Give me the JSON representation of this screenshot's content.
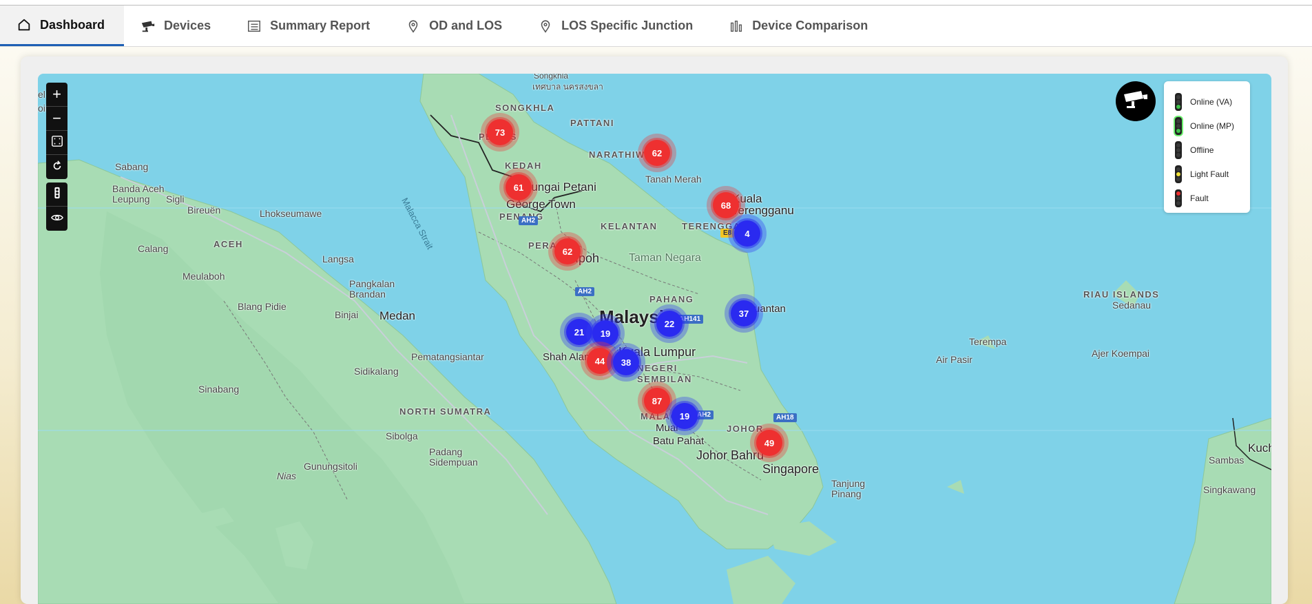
{
  "tabs": [
    {
      "label": "Dashboard",
      "icon": "home-icon",
      "active": true
    },
    {
      "label": "Devices",
      "icon": "cctv-camera-icon"
    },
    {
      "label": "Summary Report",
      "icon": "report-list-icon"
    },
    {
      "label": "OD and LOS",
      "icon": "location-pin-icon"
    },
    {
      "label": "LOS Specific Junction",
      "icon": "location-pin-icon"
    },
    {
      "label": "Device Comparison",
      "icon": "bar-chart-icon"
    }
  ],
  "map": {
    "controls": {
      "zoom_in": "+",
      "zoom_out": "−",
      "fullscreen_icon": "fullscreen-icon",
      "reset_icon": "refresh-icon",
      "traffic_toggle_icon": "traffic-light-icon",
      "visibility_icon": "eye-icon"
    },
    "camera_button_icon": "cctv-camera-icon",
    "legend": [
      {
        "label": "Online (VA)",
        "lamp": "green",
        "color": "#3fc24a"
      },
      {
        "label": "Online (MP)",
        "lamp": "green-outline",
        "color": "#6df06f"
      },
      {
        "label": "Offline",
        "lamp": "none",
        "color": "#3a3a3a"
      },
      {
        "label": "Light Fault",
        "lamp": "yellow",
        "color": "#f2e23a"
      },
      {
        "label": "Fault",
        "lamp": "red",
        "color": "#ee3030"
      }
    ],
    "clusters": [
      {
        "count": "73",
        "color": "red"
      },
      {
        "count": "62",
        "color": "red"
      },
      {
        "count": "61",
        "color": "red"
      },
      {
        "count": "68",
        "color": "red"
      },
      {
        "count": "4",
        "color": "blue"
      },
      {
        "count": "62",
        "color": "red"
      },
      {
        "count": "37",
        "color": "blue"
      },
      {
        "count": "22",
        "color": "blue"
      },
      {
        "count": "21",
        "color": "blue"
      },
      {
        "count": "19",
        "color": "blue"
      },
      {
        "count": "44",
        "color": "red"
      },
      {
        "count": "38",
        "color": "blue"
      },
      {
        "count": "87",
        "color": "red"
      },
      {
        "count": "19",
        "color": "blue"
      },
      {
        "count": "49",
        "color": "red"
      }
    ],
    "labels": {
      "songkhla_th": "Songkhla",
      "songkhla_thai": "เทศบาล นครสงขลา",
      "songkhla": "SONGKHLA",
      "pattani": "PATTANI",
      "perlis": "PERLIS",
      "narathiwat": "NARATHIWAT",
      "kedah": "KEDAH",
      "tanah_merah": "Tanah Merah",
      "sungai_petani": "Sungai Petani",
      "george_town": "George Town",
      "penang": "PENANG",
      "kelantan": "KELANTAN",
      "kuala_terengganu": "Kuala Terengganu",
      "terengganu": "TERENGGANU",
      "perak": "PERAK",
      "ipoh": "Ipoh",
      "taman_negara": "Taman Negara",
      "pahang": "PAHANG",
      "malaysia": "Malaysia",
      "kuantan": "Kuantan",
      "shah_alam": "Shah Alam",
      "kuala_lumpur": "Kuala Lumpur",
      "negeri_sembilan": "NEGERI SEMBILAN",
      "malacca": "MALACCA",
      "muar": "Muar",
      "batu_pahat": "Batu Pahat",
      "johor": "JOHOR",
      "johor_bahru": "Johor Bahru",
      "singapore": "Singapore",
      "tanjung_pinang": "Tanjung Pinang",
      "sabang": "Sabang",
      "banda_aceh": "Banda Aceh",
      "leupung": "Leupung",
      "sigli": "Sigli",
      "bireuen": "Bireuën",
      "lhokseumawe": "Lhokseumawe",
      "aceh": "ACEH",
      "calang": "Calang",
      "langsa": "Langsa",
      "meulaboh": "Meulaboh",
      "pangkalan_brandan": "Pangkalan Brandan",
      "blang_pidie": "Blang Pidie",
      "binjai": "Binjai",
      "medan": "Medan",
      "pematangsiantar": "Pematangsiantar",
      "sidikalang": "Sidikalang",
      "sinabang": "Sinabang",
      "north_sumatra": "NORTH SUMATRA",
      "sibolga": "Sibolga",
      "padang_sidempuan": "Padang Sidempuan",
      "gunungsitoli": "Gunungsitoli",
      "nias": "Nias",
      "malacca_strait": "Malacca Strait",
      "riau_islands": "RIAU ISLANDS",
      "sedanau": "Sedanau",
      "terempa": "Terempa",
      "air_pasir": "Air Pasir",
      "ajer_koempai": "Ajer Koempai",
      "kuching": "Kuchi",
      "sambas": "Sambas",
      "singkawang": "Singkawang",
      "shield_ah2": "AH2",
      "shield_ah2b": "AH2",
      "shield_ah141": "AH141",
      "shield_ah2c": "AH2",
      "shield_ah18": "AH18",
      "shield_e8": "E8",
      "left_edge_1": "el",
      "left_edge_2": "oir"
    }
  }
}
